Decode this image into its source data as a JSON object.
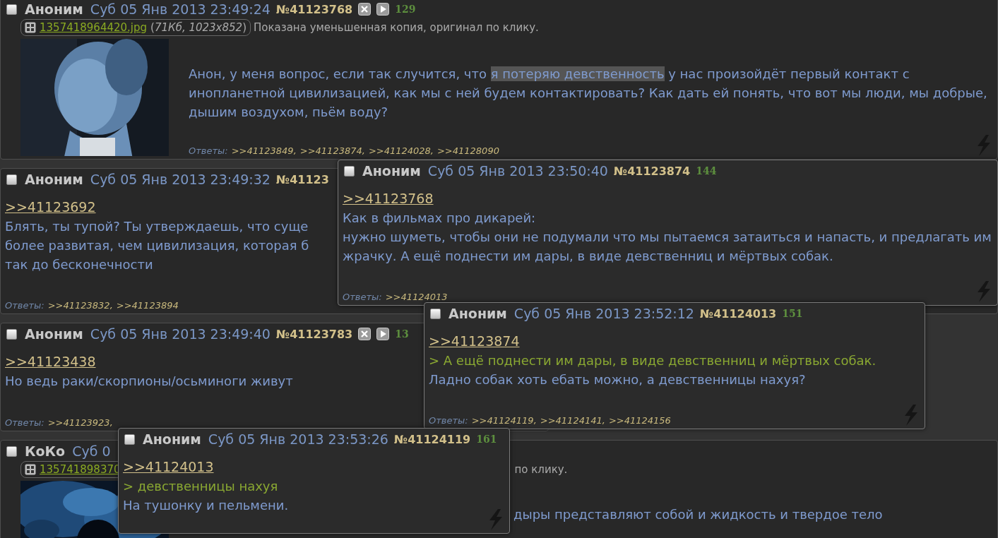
{
  "posts": [
    {
      "checked": false,
      "name": "Аноним",
      "date": "Суб 05 Янв 2013 23:49:24",
      "number": "№41123768",
      "controls": true,
      "count": "129",
      "file": {
        "name": "1357418964420.jpg",
        "info": "(*71Кб, 1023x852*)",
        "note": "Показана уменьшенная копия, оригинал по клику."
      },
      "thumbnail": {
        "kind": "picture"
      },
      "message": [
        {
          "kind": "text",
          "parts": [
            {
              "text": "Анон, у меня вопрос, если так случится, что ",
              "highlighted": false
            },
            {
              "text": "я потеряю девственность",
              "highlighted": true
            },
            {
              "text": " у нас произойдёт первый контакт с инопланетной цивилизацией, как мы с ней будем контактировать? Как дать ей понять, что вот мы люди, мы добрые, дышим воздухом, пьём воду?",
              "highlighted": false
            }
          ]
        }
      ],
      "replies": {
        "label": "Ответы:",
        "links": [
          ">>41123849,",
          ">>41123874,",
          ">>41124028,",
          ">>41128090"
        ]
      }
    },
    {
      "checked": false,
      "name": "Аноним",
      "date": "Суб 05 Янв 2013 23:49:32",
      "number": "№41123",
      "controls": false,
      "message": [
        {
          "kind": "link",
          "text": ">>41123692"
        },
        {
          "kind": "text",
          "text": "Блять, ты тупой? Ты утверждаешь, что суще"
        },
        {
          "kind": "text",
          "text": "более развитая, чем цивилизация, которая б"
        },
        {
          "kind": "text",
          "text": "так до бесконечности"
        }
      ],
      "replies": {
        "label": "Ответы:",
        "links": [
          ">>41123832,",
          ">>41123894"
        ]
      }
    },
    {
      "checked": false,
      "name": "Аноним",
      "date": "Суб 05 Янв 2013 23:49:40",
      "number": "№41123783",
      "controls": true,
      "count": "13",
      "message": [
        {
          "kind": "link",
          "text": ">>41123438"
        },
        {
          "kind": "text",
          "text": "Но ведь раки/скорпионы/осьминоги живут"
        }
      ],
      "replies": {
        "label": "Ответы:",
        "links": [
          ">>41123923,"
        ]
      }
    },
    {
      "checked": false,
      "name": "КоКо",
      "date": "Суб 0",
      "controls": false,
      "file": {
        "name": "135741898370",
        "note": "по клику."
      },
      "thumbnail": {
        "kind": "picture"
      },
      "message": [
        {
          "kind": "text",
          "text": "дыры представляют собой и жидкость и твердое тело"
        }
      ]
    }
  ],
  "popups": [
    {
      "checked": false,
      "name": "Аноним",
      "date": "Суб 05 Янв 2013 23:50:40",
      "number": "№41123874",
      "count": "144",
      "message": [
        {
          "kind": "link",
          "text": ">>41123768"
        },
        {
          "kind": "text",
          "text": "Как в фильмах про дикарей:"
        },
        {
          "kind": "text",
          "text": "нужно шуметь, чтобы они не подумали что мы пытаемся затаиться и напасть, и предлагать им жрачку. А ещё поднести им дары, в виде девственниц и мёртвых собак."
        }
      ],
      "replies": {
        "label": "Ответы:",
        "links": [
          ">>41124013"
        ]
      }
    },
    {
      "checked": false,
      "name": "Аноним",
      "date": "Суб 05 Янв 2013 23:52:12",
      "number": "№41124013",
      "count": "151",
      "message": [
        {
          "kind": "link",
          "text": ">>41123874"
        },
        {
          "kind": "quote",
          "text": "> А ещё поднести им дары, в виде девственниц и мёртвых собак."
        },
        {
          "kind": "text",
          "text": "Ладно собак хоть ебать можно, а девственницы нахуя?"
        }
      ],
      "replies": {
        "label": "Ответы:",
        "links": [
          ">>41124119,",
          ">>41124141,",
          ">>41124156"
        ]
      }
    },
    {
      "checked": false,
      "name": "Аноним",
      "date": "Суб 05 Янв 2013 23:53:26",
      "number": "№41124119",
      "count": "161",
      "message": [
        {
          "kind": "link",
          "text": ">>41124013"
        },
        {
          "kind": "quote",
          "text": "> девственницы нахуя"
        },
        {
          "kind": "text",
          "text": "На тушонку и пельмени."
        }
      ]
    }
  ]
}
